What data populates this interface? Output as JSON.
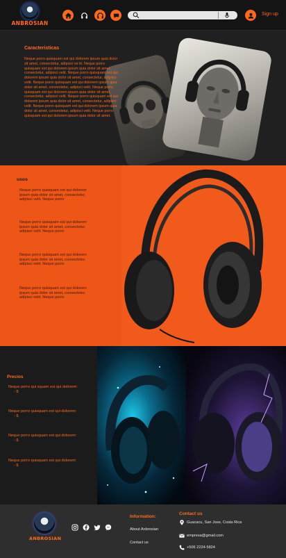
{
  "header": {
    "brand": "ANBROSIAN",
    "nav_icons": [
      "home-icon",
      "headphones-icon",
      "headset-support-icon",
      "chat-icon"
    ],
    "search": {
      "placeholder": ""
    },
    "signup_label": "Sign up",
    "colors": {
      "accent": "#ff6a1a",
      "header_bg": "#141414"
    }
  },
  "caracteristicas": {
    "title": "Caracteristicas",
    "body": "Neque porro quisquam est qui dolorem ipsum quia dolor sit amet, consectetur, adipisci ve lit. Neque porro quisquam est qui dolorem ipsum quia dolor sit amet, consectetur, adipisci velit. Neque porro quisquam est qui dolorem ipsum quia dolor sit amet, consectetur, adipisci velit. Neque porro quisquam est qui dolorem ipsum quia dolor sit amet, consectetur, adipisci velit. Neque porro quisquam est qui dolorem ipsum quia dolor sit amet, consectetur, adipisci velit. Neque porro quisquam est qui dolorem ipsum quia dolor sit amet, consectetur, adipisci velit. Neque porro quisquam est qui dolorem ipsum quia dolor sit amet, consectetur, adipisci velit. Neque porro quisquam est qui dolorem ipsum quia dolor sit amet."
  },
  "usos": {
    "title": "usos",
    "items": [
      "Neque porro quisquam est qui dolorem ipsum quia dolor sit amet, consectetur, adipisci velit. Neque porro",
      "Neque porro quisquam est qui dolorem ipsum quia dolor sit amet, consectetur, adipisci velit. Neque porro",
      "Neque porro quisquam est qui dolorem ipsum quia dolor sit amet, consectetur, adipisci velit. Neque porro",
      "Neque porro quisquam est qui dolorem ipsum quia dolor sit amet, consectetur, adipisci velit. Neque porro"
    ]
  },
  "precios": {
    "title": "Precios",
    "items": [
      {
        "text": "Neque porro qui      squam est qui dolorem:",
        "price": "- $"
      },
      {
        "text": "Neque porro quisquam est qui dolorem:",
        "price": "- $"
      },
      {
        "text": "Neque porro quisquam est qui dolorem:",
        "price": "- $"
      },
      {
        "text": "Neque porro quisquam est qui dolorem:",
        "price": "- $"
      }
    ]
  },
  "footer": {
    "brand": "ANBROSIAN",
    "socials": [
      "instagram-icon",
      "facebook-icon",
      "twitter-icon",
      "messenger-icon"
    ],
    "information_title": "Information:",
    "links": [
      "About Anbrosian",
      "Contact us"
    ],
    "contact_title": "Contact us",
    "address": "Guacacu, San Jose, Costa Rica",
    "email": "empresa@gmail.com",
    "phone": "+506 2224-5824"
  }
}
